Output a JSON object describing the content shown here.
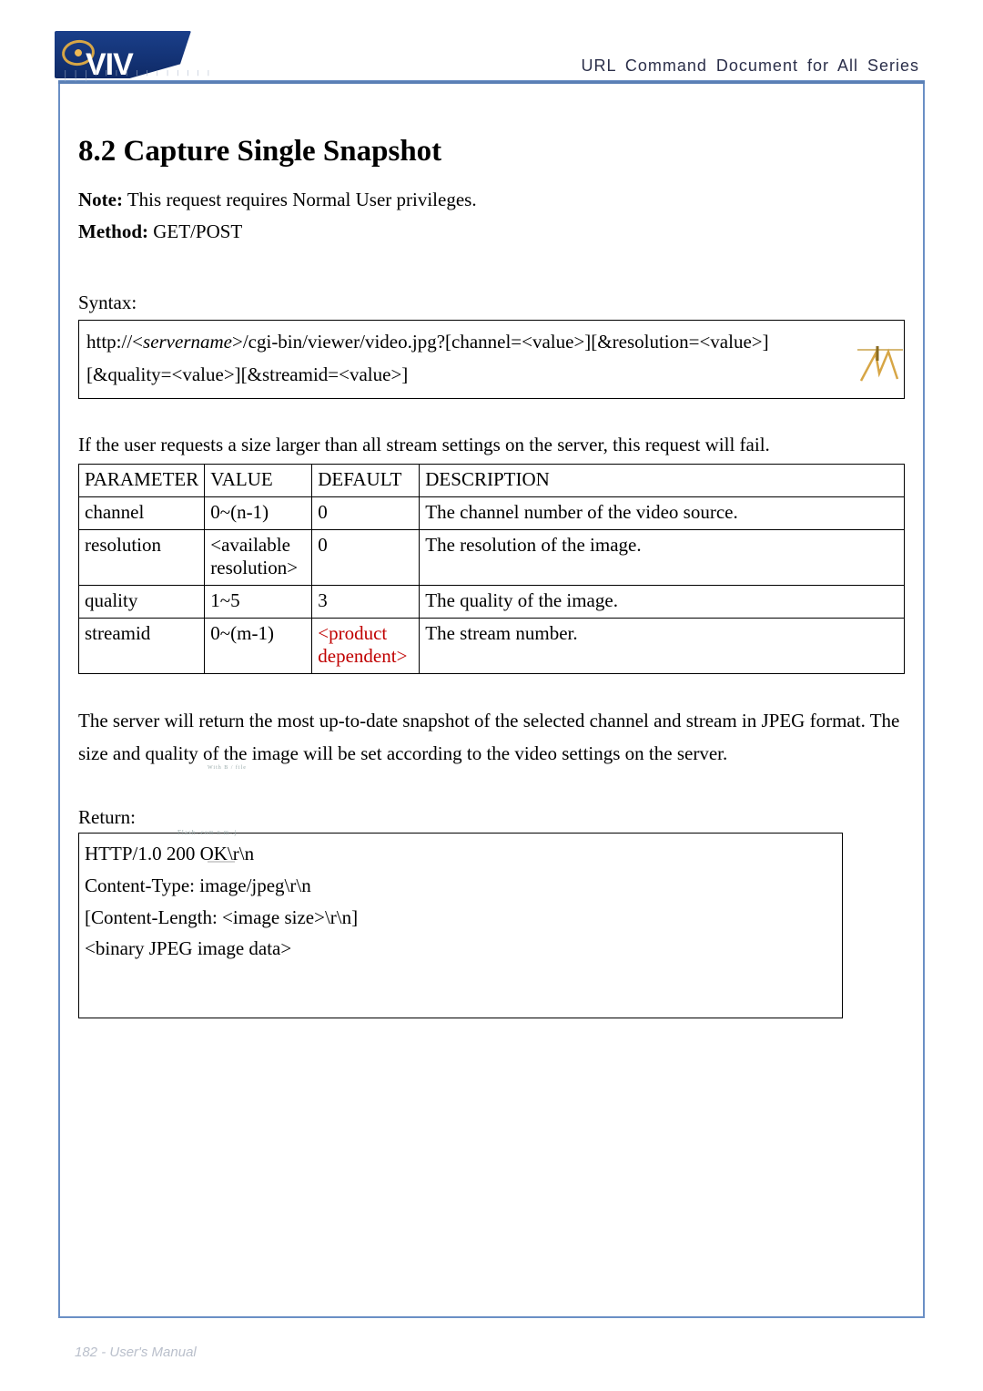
{
  "header": {
    "title": "URL Command Document for All Series",
    "logo_text": "VIV",
    "logo_stripes": "| | | | | | | | | |\n| | | | | | | |"
  },
  "section": {
    "title": "8.2 Capture Single Snapshot",
    "note_bold": "Note:",
    "note_text": " This request requires Normal User privileges.",
    "method_bold": "Method:",
    "method_text": " GET/POST",
    "syntax_label": "Syntax:",
    "syntax_line1a": "http://<",
    "syntax_line1b_italic": "servername",
    "syntax_line1c": ">/cgi-bin/viewer/video.jpg?[channel=<value>][&resolution=<value>]",
    "syntax_line2": "[&quality=<value>][&streamid=<value>]",
    "intro_fail": "If the user requests a size larger than all stream settings on the server, this request will fail."
  },
  "table": {
    "headers": [
      "PARAMETER",
      "VALUE",
      "DEFAULT",
      "DESCRIPTION"
    ],
    "rows": [
      {
        "param": "channel",
        "value": "0~(n-1)",
        "default": "0",
        "default_red": false,
        "desc": "The channel number of the video source."
      },
      {
        "param": "resolution",
        "value": "<available resolution>",
        "default": "0",
        "default_red": false,
        "desc": "The resolution of the image."
      },
      {
        "param": "quality",
        "value": "1~5",
        "default": "3",
        "default_red": false,
        "desc": "The quality of the image."
      },
      {
        "param": "streamid",
        "value": "0~(m-1)",
        "default": "<product dependent>",
        "default_red": true,
        "desc": "The stream number."
      }
    ]
  },
  "body_text": "The server will return the most up-to-date snapshot of the selected channel and stream in JPEG format. The size and quality of the image will be set according to the video settings on the server.",
  "return": {
    "label": "Return:",
    "lines": [
      "HTTP/1.0 200 OK\\r\\n",
      "Content-Type: image/jpeg\\r\\n",
      "[Content-Length: <image size>\\r\\n]",
      "",
      "<binary JPEG image data>"
    ]
  },
  "footer": "182 - User's Manual",
  "tiny": {
    "a": "With\nB /\nfile",
    "b": "Flash\n.com  n m .j"
  }
}
